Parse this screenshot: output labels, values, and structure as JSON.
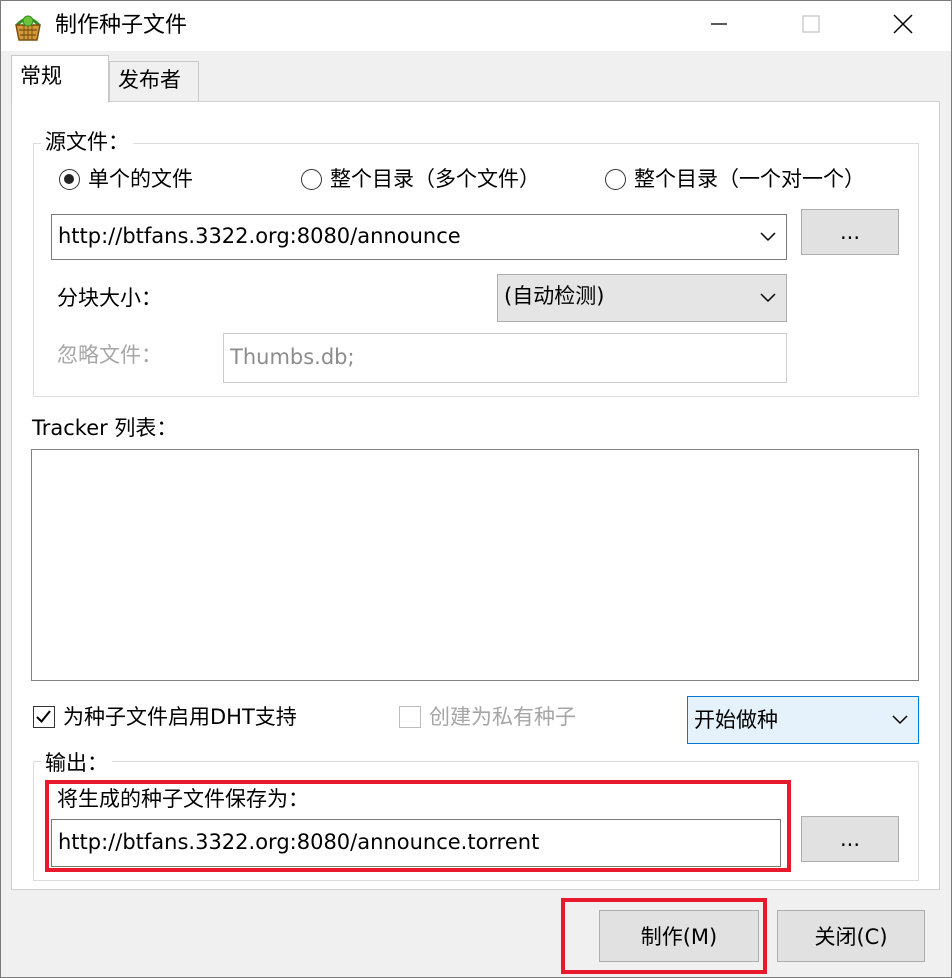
{
  "window": {
    "title": "制作种子文件"
  },
  "tabs": [
    {
      "label": "常规",
      "active": true
    },
    {
      "label": "发布者",
      "active": false
    }
  ],
  "source": {
    "group_title": "源文件：",
    "radios": [
      {
        "label": "单个的文件",
        "checked": true
      },
      {
        "label": "整个目录（多个文件）",
        "checked": false
      },
      {
        "label": "整个目录（一个对一个）",
        "checked": false
      }
    ],
    "path_value": "http://btfans.3322.org:8080/announce",
    "browse_label": "...",
    "block_size_label": "分块大小：",
    "block_size_value": "(自动检测)",
    "ignore_label": "忽略文件：",
    "ignore_value": "Thumbs.db;"
  },
  "tracker": {
    "label": "Tracker 列表："
  },
  "options": {
    "dht_label": "为种子文件启用DHT支持",
    "dht_checked": true,
    "private_label": "创建为私有种子",
    "private_checked": false,
    "seed_mode_value": "开始做种"
  },
  "output": {
    "group_title": "输出：",
    "save_as_label": "将生成的种子文件保存为：",
    "save_path_value": "http://btfans.3322.org:8080/announce.torrent",
    "browse_label": "..."
  },
  "footer": {
    "make_button": "制作(M)",
    "close_button": "关闭(C)"
  },
  "colors": {
    "highlight_box": "#e8192c",
    "focus_border": "#0078d7"
  }
}
